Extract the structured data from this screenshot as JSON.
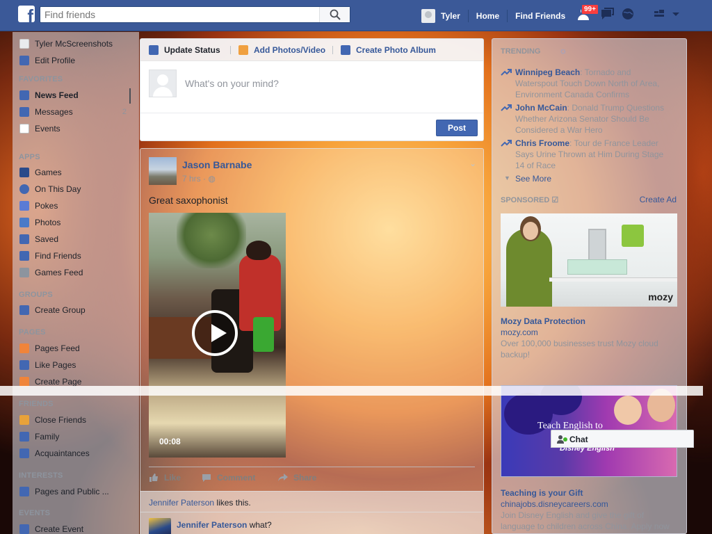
{
  "header": {
    "logo_letter": "f",
    "search_placeholder": "Find friends",
    "user_name": "Tyler",
    "nav_home": "Home",
    "nav_find_friends": "Find Friends",
    "notifications_badge": "99+"
  },
  "left_nav": {
    "profile_name": "Tyler McScreenshots",
    "edit_profile": "Edit Profile",
    "favorites_header": "FAVORITES",
    "favorites": [
      {
        "label": "News Feed",
        "icon": "news-feed-icon"
      },
      {
        "label": "Messages",
        "icon": "messages-icon",
        "count": "2"
      },
      {
        "label": "Events",
        "icon": "calendar-icon"
      }
    ],
    "apps_header": "APPS",
    "apps": [
      {
        "label": "Games",
        "icon": "games-icon"
      },
      {
        "label": "On This Day",
        "icon": "on-this-day-icon"
      },
      {
        "label": "Pokes",
        "icon": "poke-icon"
      },
      {
        "label": "Photos",
        "icon": "photos-icon"
      },
      {
        "label": "Saved",
        "icon": "bookmark-icon"
      },
      {
        "label": "Find Friends",
        "icon": "find-friends-icon"
      },
      {
        "label": "Games Feed",
        "icon": "controller-icon"
      }
    ],
    "groups_header": "GROUPS",
    "groups": [
      {
        "label": "Create Group",
        "icon": "plus-icon"
      }
    ],
    "pages_header": "PAGES",
    "pages": [
      {
        "label": "Pages Feed",
        "icon": "flag-icon"
      },
      {
        "label": "Like Pages",
        "icon": "thumbs-up-icon"
      },
      {
        "label": "Create Page",
        "icon": "plus-icon"
      }
    ],
    "friends_header": "FRIENDS",
    "friends": [
      {
        "label": "Close Friends",
        "icon": "star-icon"
      },
      {
        "label": "Family",
        "icon": "family-icon"
      },
      {
        "label": "Acquaintances",
        "icon": "acquaintances-icon"
      }
    ],
    "interests_header": "INTERESTS",
    "interests": [
      {
        "label": "Pages and Public ...",
        "icon": "pages-public-icon"
      }
    ],
    "events_header": "EVENTS",
    "events": [
      {
        "label": "Create Event",
        "icon": "plus-icon"
      }
    ]
  },
  "composer": {
    "tab_update_status": "Update Status",
    "tab_add_photos": "Add Photos/Video",
    "tab_create_album": "Create Photo Album",
    "placeholder": "What's on your mind?",
    "post_button": "Post"
  },
  "story": {
    "author": "Jason Barnabe",
    "time": "7 hrs",
    "text": "Great saxophonist",
    "video_duration": "00:08",
    "action_like": "Like",
    "action_comment": "Comment",
    "action_share": "Share",
    "like_name": "Jennifer Paterson",
    "like_suffix": " likes this.",
    "comment_author": "Jennifer Paterson",
    "comment_text": " what?"
  },
  "trending": {
    "header": "TRENDING",
    "items": [
      {
        "topic": "Winnipeg Beach",
        "desc": ": Tornado and Waterspout Touch Down North of Area, Environment Canada Confirms"
      },
      {
        "topic": "John McCain",
        "desc": ": Donald Trump Questions Whether Arizona Senator Should Be Considered a War Hero"
      },
      {
        "topic": "Chris Froome",
        "desc": ": Tour de France Leader Says Urine Thrown at Him During Stage 14 of Race"
      }
    ],
    "see_more": "See More"
  },
  "sponsored": {
    "header": "SPONSORED",
    "create_ad": "Create Ad",
    "ads": [
      {
        "image_brand": "mozy",
        "title": "Mozy Data Protection",
        "domain": "mozy.com",
        "desc": "Over 100,000 businesses trust Mozy cloud backup!"
      },
      {
        "image_text": "Teach English to",
        "image_brand": "Disney English",
        "title": "Teaching is your Gift",
        "domain": "chinajobs.disneycareers.com",
        "desc": "Join Disney English and give the gift of language to children across China. Apply now"
      }
    ]
  },
  "chat": {
    "label": "Chat"
  },
  "colors": {
    "brand_blue": "#3b5998",
    "link_blue": "#365899",
    "post_button": "#4267b2",
    "badge_red": "#fa3e3e",
    "online_green": "#42b72a"
  }
}
